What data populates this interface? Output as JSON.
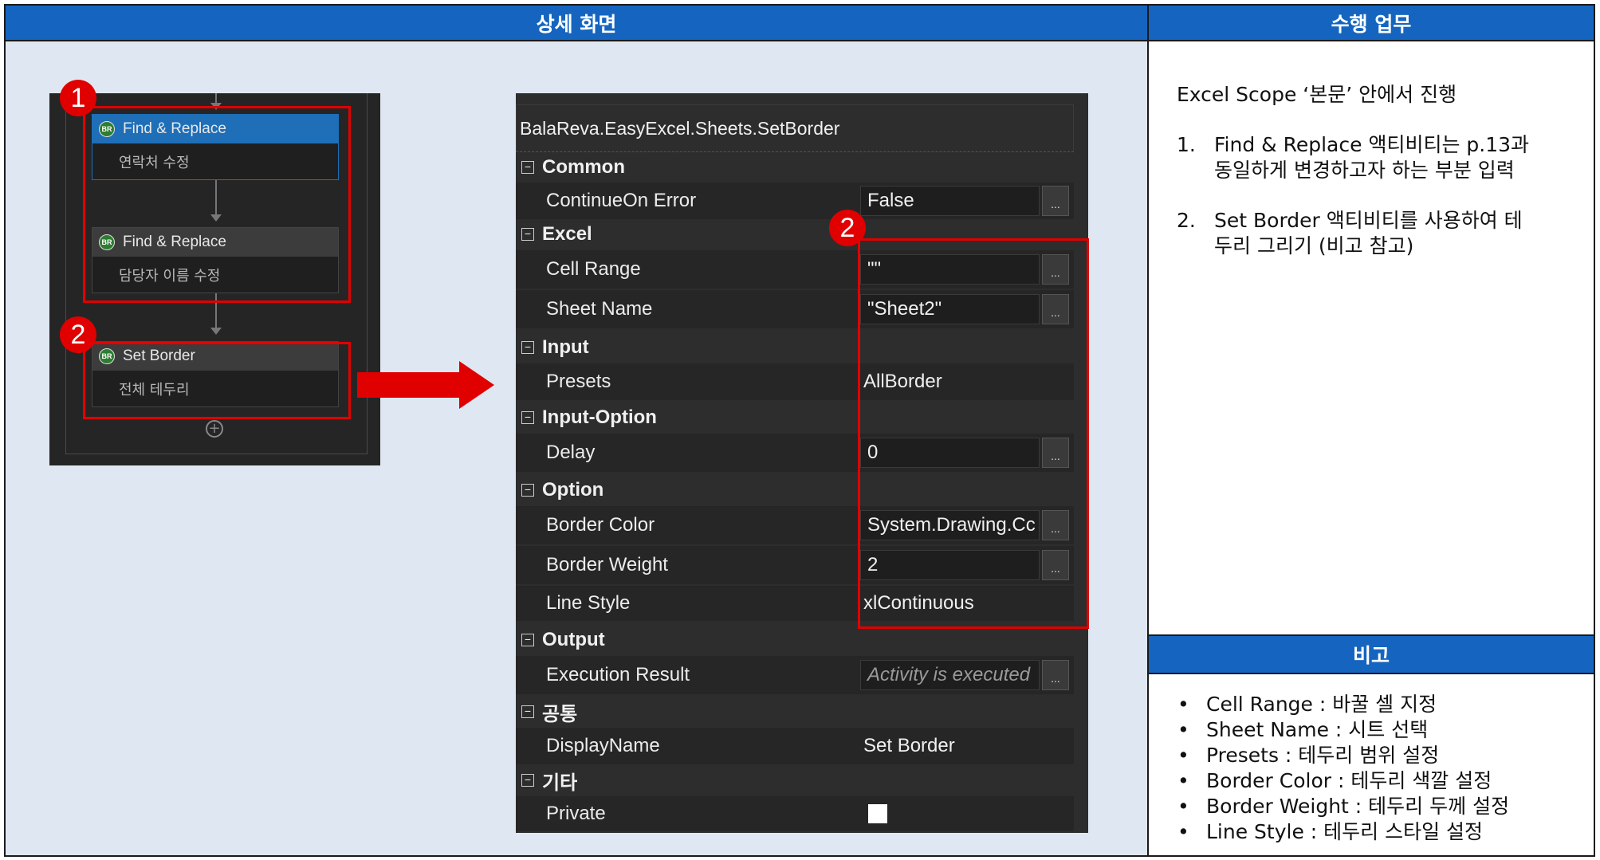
{
  "headers": {
    "detail_screen": "상세 화면",
    "task": "수행 업무",
    "notes": "비고"
  },
  "workflow": {
    "activities": [
      {
        "badge": "BR",
        "title": "Find & Replace",
        "subtitle": "연락처 수정"
      },
      {
        "badge": "BR",
        "title": "Find & Replace",
        "subtitle": "담당자 이름 수정"
      },
      {
        "badge": "BR",
        "title": "Set Border",
        "subtitle": "전체 테두리"
      }
    ],
    "markers": [
      "1",
      "2"
    ]
  },
  "properties": {
    "title": "BalaReva.EasyExcel.Sheets.SetBorder",
    "marker": "2",
    "toggle_symbol": "⊟",
    "ellipsis": "...",
    "categories": [
      {
        "name": "Common",
        "props": [
          {
            "name": "ContinueOn Error",
            "value": "False"
          }
        ]
      },
      {
        "name": "Excel",
        "props": [
          {
            "name": "Cell Range",
            "value": "\"\""
          },
          {
            "name": "Sheet Name",
            "value": "\"Sheet2\""
          }
        ]
      },
      {
        "name": "Input",
        "props": [
          {
            "name": "Presets",
            "value": "AllBorder"
          }
        ]
      },
      {
        "name": "Input-Option",
        "props": [
          {
            "name": "Delay",
            "value": "0"
          }
        ]
      },
      {
        "name": "Option",
        "props": [
          {
            "name": "Border Color",
            "value": "System.Drawing.Cc"
          },
          {
            "name": "Border Weight",
            "value": "2"
          },
          {
            "name": "Line Style",
            "value": "xlContinuous"
          }
        ]
      },
      {
        "name": "Output",
        "props": [
          {
            "name": "Execution Result",
            "value": "Activity is executed"
          }
        ]
      },
      {
        "name": "공통",
        "props": [
          {
            "name": "DisplayName",
            "value": "Set Border"
          }
        ]
      },
      {
        "name": "기타",
        "props": [
          {
            "name": "Private",
            "value": ""
          }
        ]
      }
    ]
  },
  "task": {
    "intro": "Excel Scope ‘본문’ 안에서 진행",
    "steps": [
      {
        "n": "1.",
        "line1": "Find & Replace 액티비티는 p.13과",
        "line2": "동일하게 변경하고자 하는 부분 입력"
      },
      {
        "n": "2.",
        "line1": "Set Border 액티비티를 사용하여 테",
        "line2": "두리 그리기 (비고 참고)"
      }
    ]
  },
  "notes": {
    "items": [
      "Cell Range : 바꿀 셀 지정",
      "Sheet Name : 시트 선택",
      "Presets : 테두리 범위 설정",
      "Border Color : 테두리 색깔 설정",
      "Border Weight : 테두리 두께 설정",
      "Line Style : 테두리 스타일 설정"
    ]
  },
  "colors": {
    "header_blue": "#1565c0",
    "highlight_red": "#e00000",
    "panel_bg": "#dfe7f2"
  }
}
